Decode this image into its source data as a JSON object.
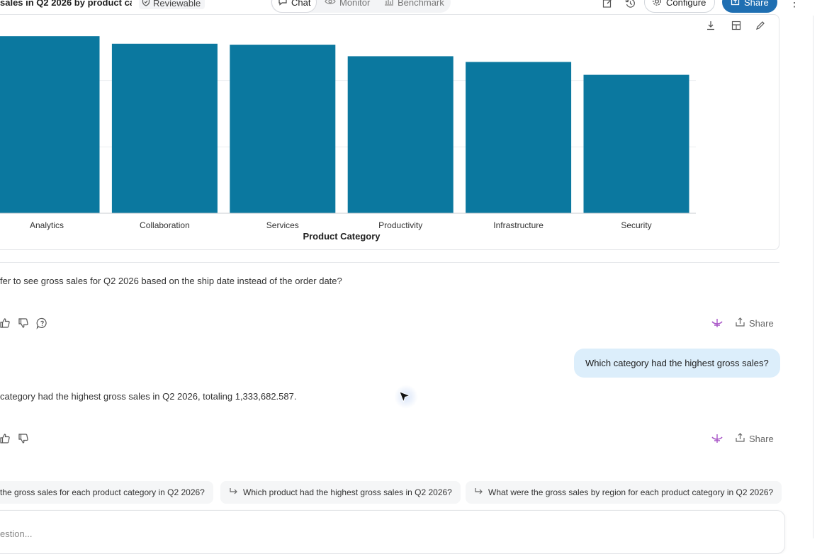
{
  "header": {
    "title": "sales in Q2 2026 by product ca",
    "badge": "Reviewable",
    "tabs": [
      {
        "label": "Chat",
        "active": true,
        "icon": "chat-bubble-icon"
      },
      {
        "label": "Monitor",
        "active": false,
        "icon": "eye-icon"
      },
      {
        "label": "Benchmark",
        "active": false,
        "icon": "bar-chart-icon"
      }
    ],
    "configure_label": "Configure",
    "share_label": "Share",
    "accent": "#1f6fb2"
  },
  "chart_data": {
    "type": "bar",
    "title": "",
    "xlabel": "Product Category",
    "ylabel": "",
    "categories": [
      "Analytics",
      "Collaboration",
      "Services",
      "Productivity",
      "Infrastructure",
      "Security"
    ],
    "values": [
      1333682587,
      1277000000,
      1270000000,
      1183000000,
      1140000000,
      1043000000
    ],
    "ylim": [
      0,
      1500000000
    ],
    "bar_color": "#0b789f",
    "grid": true
  },
  "conversation": {
    "assistant_followup": "fer to see gross sales for Q2 2026 based on the ship date instead of the order date?",
    "share_label": "Share",
    "user_question": "Which category had the highest gross sales?",
    "assistant_answer": "category had the highest gross sales in Q2 2026, totaling 1,333,682.587."
  },
  "suggestions": [
    "the gross sales for each product category in Q2 2026?",
    "Which product had the highest gross sales in Q2 2026?",
    "What were the gross sales by region for each product category in Q2 2026?"
  ],
  "composer": {
    "placeholder": "estion..."
  }
}
